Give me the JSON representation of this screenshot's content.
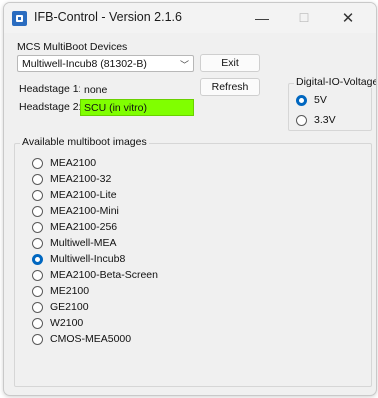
{
  "window": {
    "title": "IFB-Control - Version 2.1.6",
    "minimize_glyph": "—",
    "maximize_glyph": "☐",
    "close_glyph": "✕"
  },
  "devices": {
    "label": "MCS MultiBoot Devices",
    "selected": "Multiwell-Incub8 (81302-B)"
  },
  "buttons": {
    "exit": "Exit",
    "refresh": "Refresh"
  },
  "headstages": [
    {
      "label": "Headstage 1:",
      "value": "none"
    },
    {
      "label": "Headstage 2:",
      "value": "SCU (in vitro)",
      "color": "#80ff00"
    }
  ],
  "voltage": {
    "title": "Digital-IO-Voltage",
    "options": [
      {
        "label": "5V",
        "selected": true
      },
      {
        "label": "3.3V",
        "selected": false
      }
    ]
  },
  "images": {
    "title": "Available multiboot images",
    "items": [
      {
        "label": "MEA2100",
        "selected": false
      },
      {
        "label": "MEA2100-32",
        "selected": false
      },
      {
        "label": "MEA2100-Lite",
        "selected": false
      },
      {
        "label": "MEA2100-Mini",
        "selected": false
      },
      {
        "label": "MEA2100-256",
        "selected": false
      },
      {
        "label": "Multiwell-MEA",
        "selected": false
      },
      {
        "label": "Multiwell-Incub8",
        "selected": true
      },
      {
        "label": "MEA2100-Beta-Screen",
        "selected": false
      },
      {
        "label": "ME2100",
        "selected": false
      },
      {
        "label": "GE2100",
        "selected": false
      },
      {
        "label": "W2100",
        "selected": false
      },
      {
        "label": "CMOS-MEA5000",
        "selected": false
      }
    ]
  },
  "colors": {
    "accent": "#0067c0",
    "scu_field": "#80ff00"
  }
}
